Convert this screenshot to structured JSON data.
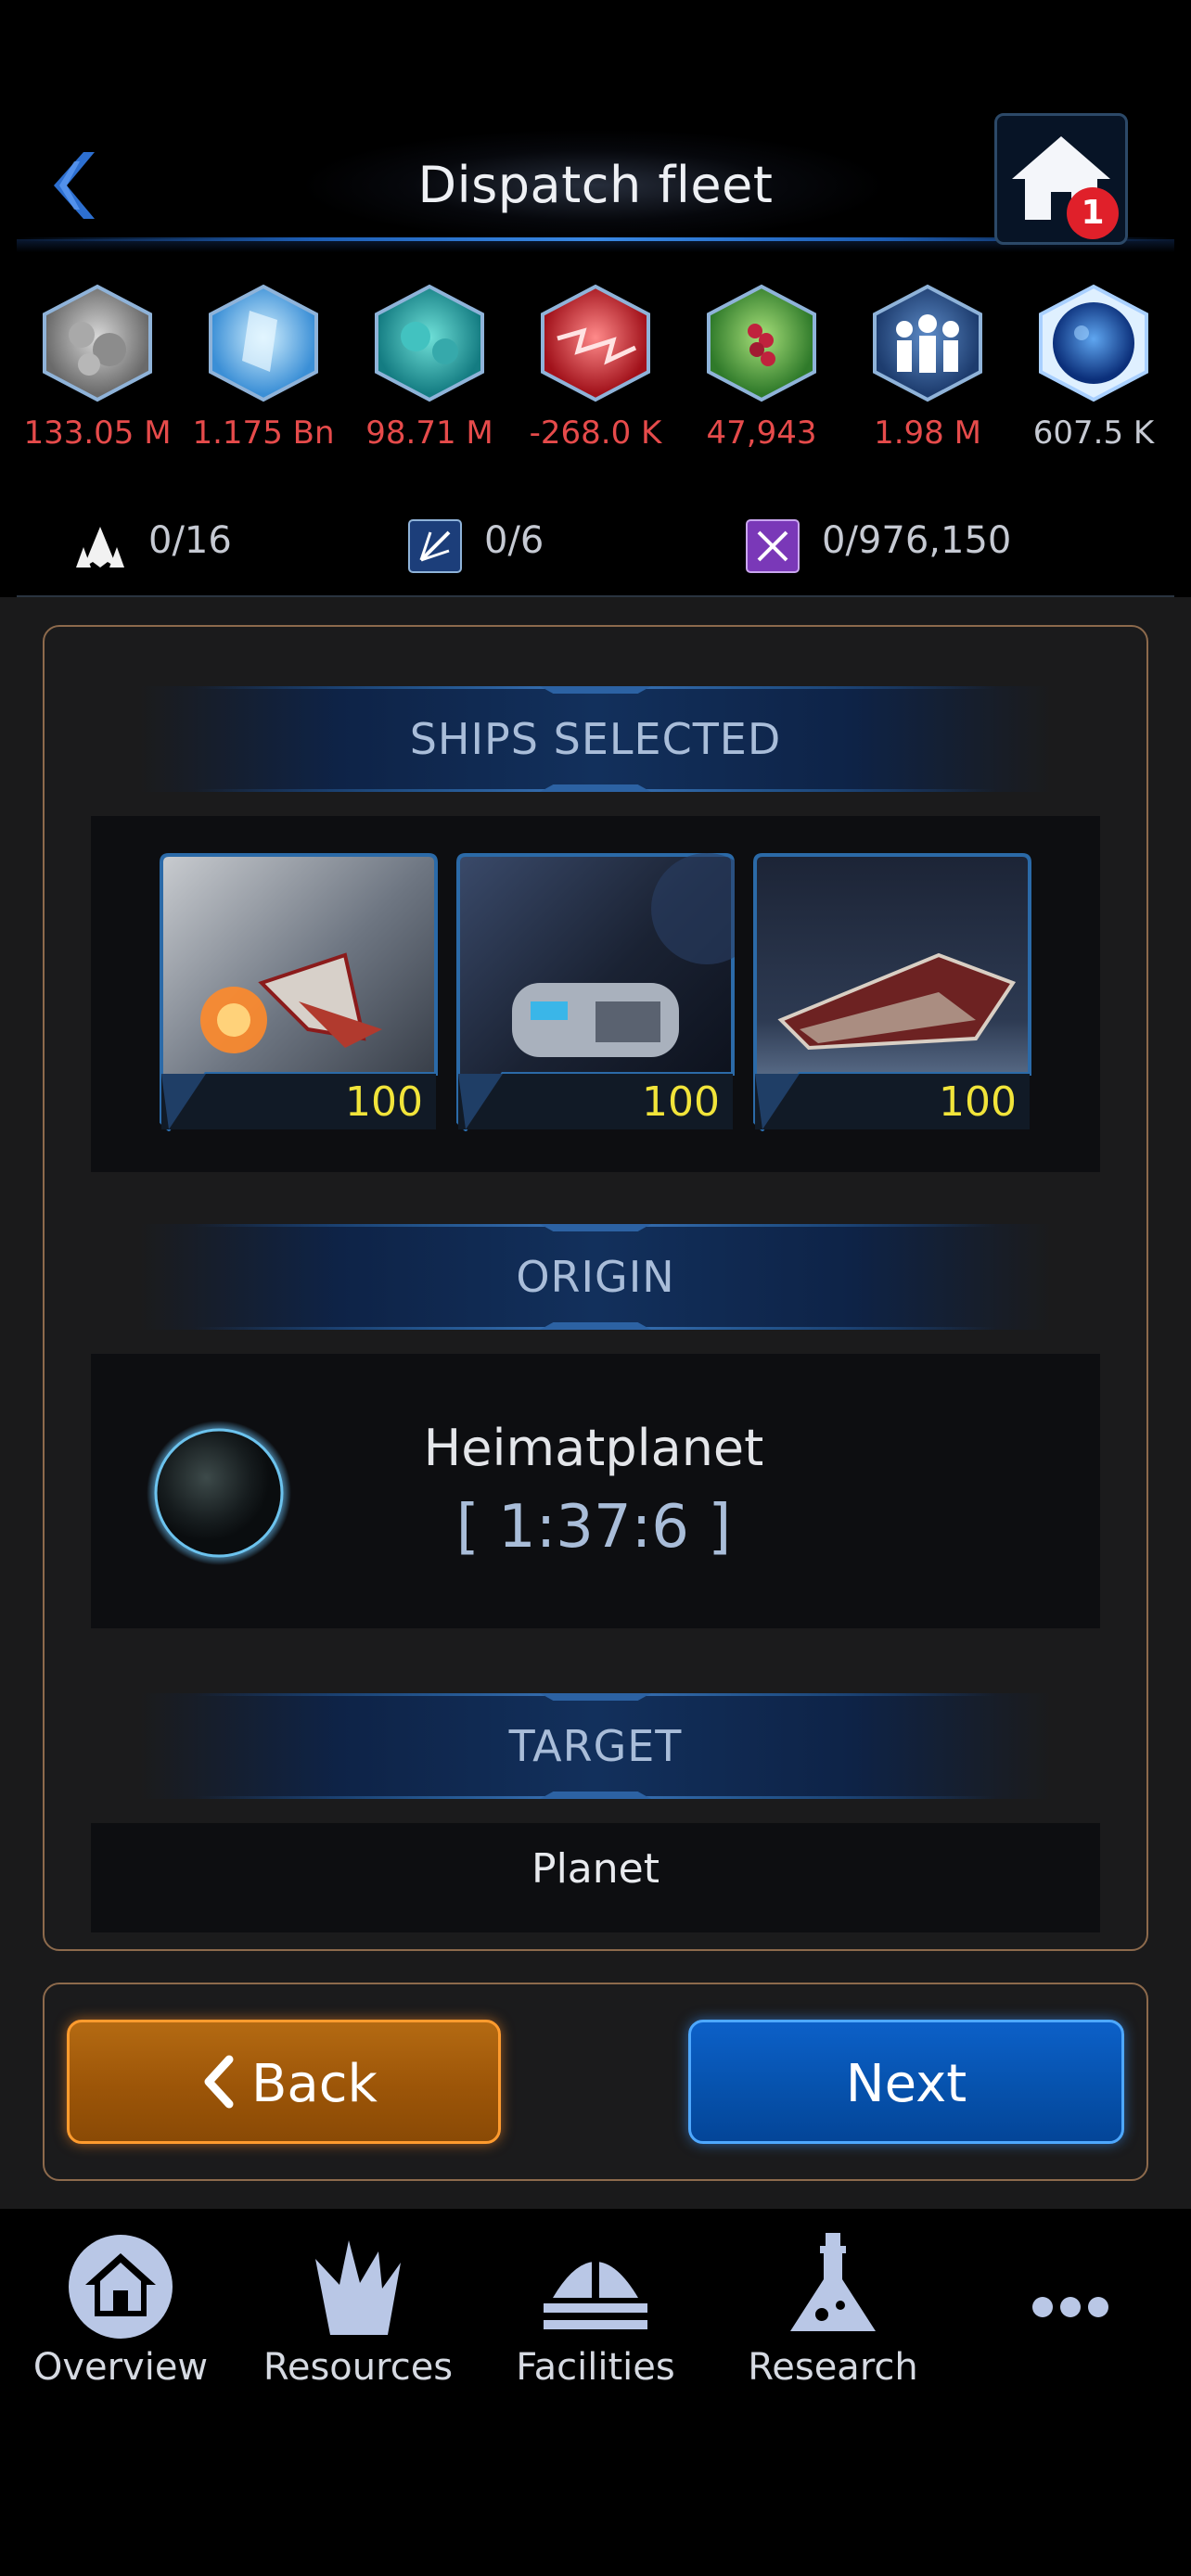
{
  "header": {
    "title": "Dispatch fleet",
    "home_badge": "1"
  },
  "resources": [
    {
      "icon": "metal-ore-icon",
      "value": "133.05 M",
      "negative": true
    },
    {
      "icon": "crystal-icon",
      "value": "1.175 Bn",
      "negative": true
    },
    {
      "icon": "deuterium-icon",
      "value": "98.71 M",
      "negative": true
    },
    {
      "icon": "energy-icon",
      "value": "-268.0 K",
      "negative": true
    },
    {
      "icon": "food-icon",
      "value": "47,943",
      "negative": true
    },
    {
      "icon": "population-icon",
      "value": "1.98 M",
      "negative": true
    },
    {
      "icon": "dark-matter-icon",
      "value": "607.5 K",
      "negative": false
    }
  ],
  "stats": [
    {
      "icon": "fleet-slots-icon",
      "value": "0/16"
    },
    {
      "icon": "expedition-slots-icon",
      "value": "0/6"
    },
    {
      "icon": "research-dna-icon",
      "value": "0/976,150"
    }
  ],
  "sections": {
    "ships_selected": "SHIPS SELECTED",
    "origin": "ORIGIN",
    "target": "TARGET"
  },
  "ships": [
    {
      "name": "fighter",
      "count": "100"
    },
    {
      "name": "transporter",
      "count": "100"
    },
    {
      "name": "cruiser",
      "count": "100"
    }
  ],
  "origin": {
    "name": "Heimatplanet",
    "coords": "[ 1:37:6 ]"
  },
  "target": {
    "value": "Planet"
  },
  "buttons": {
    "back": "Back",
    "next": "Next"
  },
  "nav": [
    {
      "icon": "home-icon",
      "label": "Overview"
    },
    {
      "icon": "crystals-icon",
      "label": "Resources"
    },
    {
      "icon": "facility-dome-icon",
      "label": "Facilities"
    },
    {
      "icon": "flask-icon",
      "label": "Research"
    },
    {
      "icon": "more-icon",
      "label": ""
    }
  ],
  "colors": {
    "negative": "#e64b4b",
    "neutral": "#c6cad3",
    "accent_blue": "#0652ad",
    "accent_orange": "#9c5508",
    "count_yellow": "#f1e43a",
    "panel_border": "#8d6a4c"
  }
}
